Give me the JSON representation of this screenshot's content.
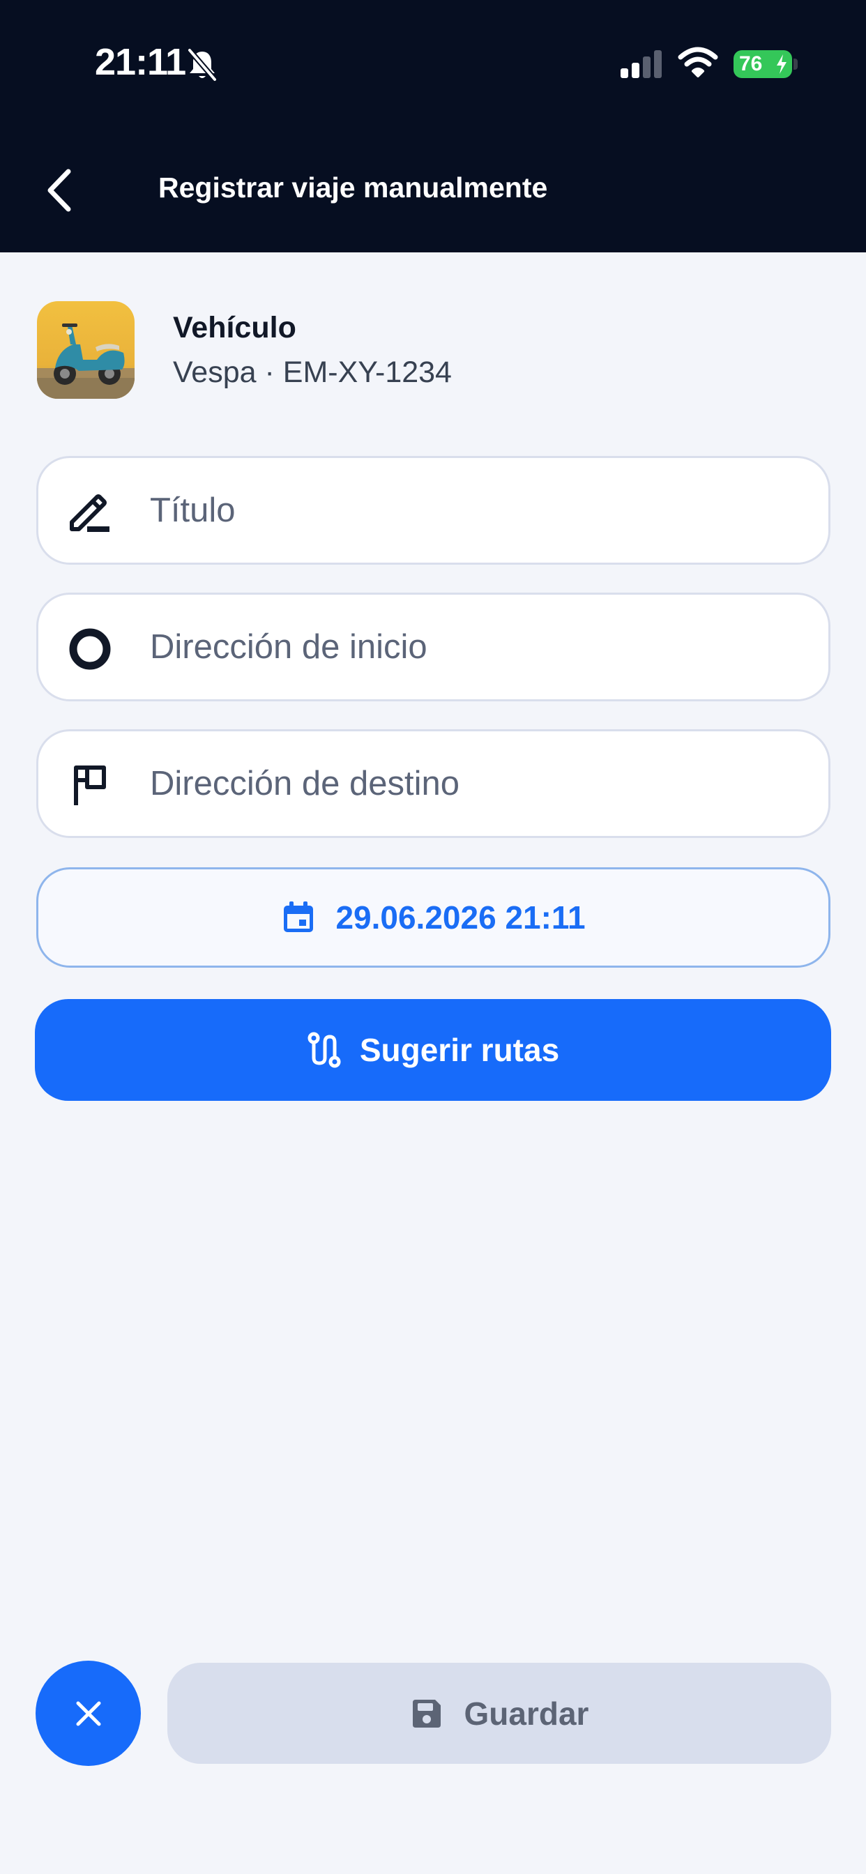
{
  "status_bar": {
    "time": "21:11",
    "battery": "76"
  },
  "header": {
    "title": "Registrar viaje manualmente"
  },
  "vehicle": {
    "label": "Vehículo",
    "detail": "Vespa · EM-XY-1234"
  },
  "form": {
    "title_placeholder": "Título",
    "start_placeholder": "Dirección de inicio",
    "destination_placeholder": "Dirección de destino",
    "datetime": "29.06.2026 21:11",
    "suggest_label": "Sugerir rutas",
    "save_label": "Guardar"
  },
  "colors": {
    "header_bg": "#060E21",
    "accent": "#176BFA",
    "page_bg": "#F3F5FA",
    "disabled_bg": "#D8DEED"
  },
  "icons": [
    "bell-slash-icon",
    "signal-icon",
    "wifi-icon",
    "battery-icon",
    "back-arrow-icon",
    "pencil-icon",
    "circle-icon",
    "flag-icon",
    "calendar-icon",
    "route-icon",
    "close-icon",
    "save-icon"
  ]
}
